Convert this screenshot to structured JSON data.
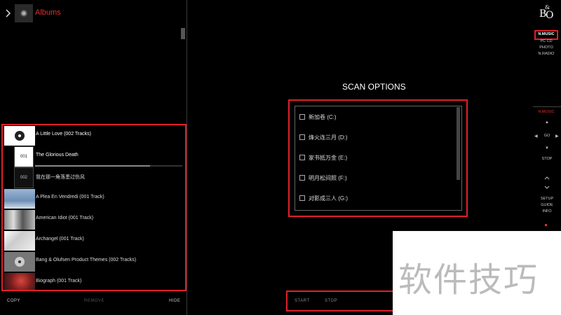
{
  "header": {
    "title": "Albums"
  },
  "tracks": [
    {
      "label": "A Little Love (002 Tracks)"
    },
    {
      "label": "The Glorious Death",
      "number": "001"
    },
    {
      "label": "我在那一角落患过伤风",
      "number": "002"
    },
    {
      "label": "A Plea En Vendredi (001 Track)"
    },
    {
      "label": "American Idiot (001 Track)"
    },
    {
      "label": "Archangel (001 Track)"
    },
    {
      "label": "Bang & Olufsen Product Themes (002 Tracks)"
    },
    {
      "label": "Biograph (001 Track)"
    }
  ],
  "playback": {
    "progress": 0.78
  },
  "left_actions": {
    "copy": "COPY",
    "remove": "REMOVE",
    "hide": "HIDE"
  },
  "scan": {
    "title": "SCAN OPTIONS",
    "drives": [
      {
        "label": "新加卷 (C:)"
      },
      {
        "label": "烽火连三月 (D:)"
      },
      {
        "label": "家书抵万金 (E:)"
      },
      {
        "label": "明月松间照 (F:)"
      },
      {
        "label": "对影成三人 (G:)"
      }
    ],
    "start": "START",
    "stop": "STOP"
  },
  "sources": [
    "N.MUSIC",
    "PC CD",
    "PHOTO",
    "N.RADIO"
  ],
  "remote": {
    "mode": "N.MUSIC",
    "go": "GO",
    "stop": "STOP",
    "setup": "SETUP",
    "guide": "GUIDE",
    "info": "INFO"
  },
  "watermark": "软件技巧",
  "colors": {
    "accent": "#e0202a",
    "background": "#000000"
  },
  "icons": [
    "chevron-right-icon",
    "disc-icon",
    "chevron-up-icon",
    "chevron-down-icon",
    "chevron-left-icon"
  ]
}
